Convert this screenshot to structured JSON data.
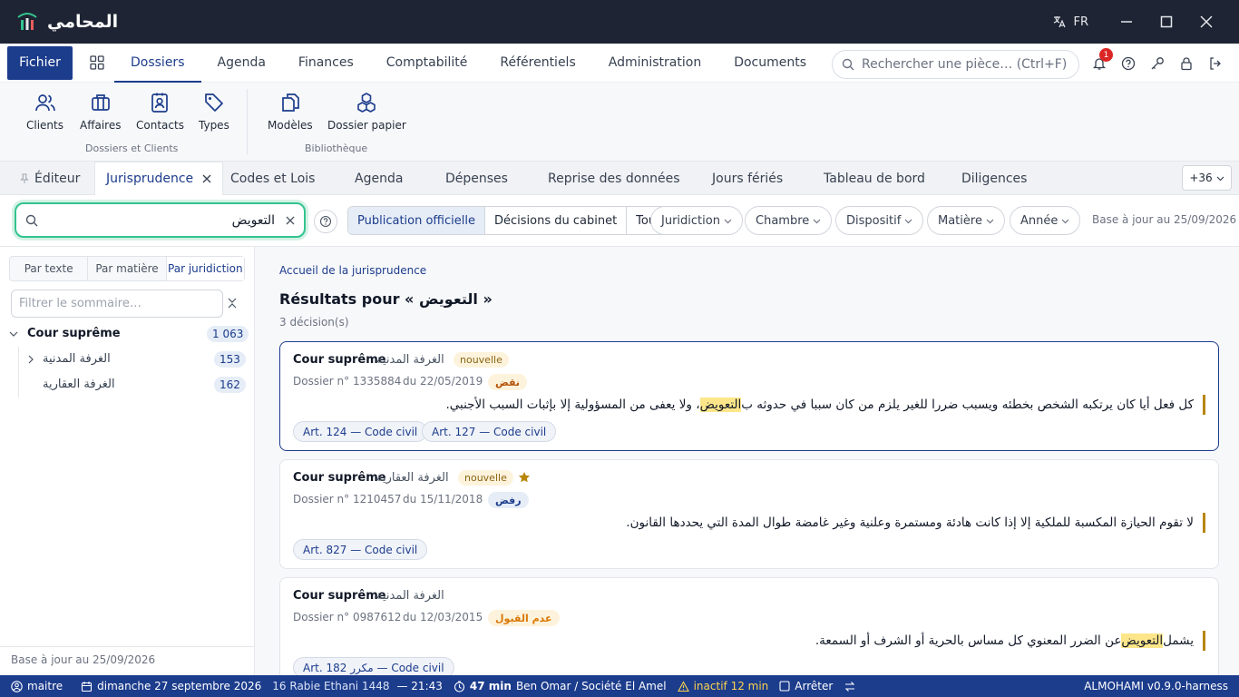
{
  "app": {
    "title": "المحامي",
    "lang": "FR"
  },
  "menubar": {
    "fichier": "Fichier",
    "items": [
      "Dossiers",
      "Agenda",
      "Finances",
      "Comptabilité",
      "Référentiels",
      "Administration",
      "Documents"
    ],
    "search_placeholder": "Rechercher une pièce… (Ctrl+F)",
    "notif_count": "1"
  },
  "ribbon": {
    "items": [
      "Clients",
      "Affaires",
      "Contacts",
      "Types",
      "Modèles",
      "Dossier papier"
    ],
    "groups": [
      "Dossiers et Clients",
      "Bibliothèque"
    ]
  },
  "tabs": {
    "items": [
      "Éditeur",
      "Jurisprudence",
      "Codes et Lois",
      "Agenda",
      "Dépenses",
      "Reprise des données",
      "Jours fériés",
      "Tableau de bord",
      "Diligences"
    ],
    "more": "+36"
  },
  "filters": {
    "query": "التعويض",
    "segments": [
      "Publication officielle",
      "Décisions du cabinet",
      "Tout"
    ],
    "dropdowns": [
      "Juridiction",
      "Chambre",
      "Dispositif",
      "Matière",
      "Année"
    ],
    "base_note": "Base à jour au 25/09/2026"
  },
  "sidebar": {
    "modes": [
      "Par texte",
      "Par matière",
      "Par juridiction"
    ],
    "filter_placeholder": "Filtrer le sommaire…",
    "tree": {
      "root": {
        "label": "Cour suprême",
        "count": "1 063"
      },
      "children": [
        {
          "label": "الغرفة المدنية",
          "count": "153"
        },
        {
          "label": "الغرفة العقارية",
          "count": "162"
        }
      ]
    },
    "footer": "Base à jour au 25/09/2026"
  },
  "main": {
    "breadcrumb": "Accueil de la jurisprudence",
    "title": "Résultats pour « التعويض »",
    "count": "3 décision(s)",
    "results": [
      {
        "court": "Cour suprême",
        "chamber": "الغرفة المدنية",
        "badge": "nouvelle",
        "dossier": "Dossier n° 1335884",
        "date": "du 22/05/2019",
        "verdict": "نقض",
        "quote_before": "كل فعل أيا كان يرتكبه الشخص بخطئه ويسبب ضررا للغير يلزم من كان سببا في حدوثه ب",
        "quote_hl": "التعويض",
        "quote_after": "، ولا يعفى من المسؤولية إلا بإثبات السبب الأجنبي.",
        "articles": [
          "Art. 124 — Code civil",
          "Art. 127 — Code civil"
        ]
      },
      {
        "court": "Cour suprême",
        "chamber": "الغرفة العقارية",
        "badge": "nouvelle",
        "dossier": "Dossier n° 1210457",
        "date": "du 15/11/2018",
        "verdict": "رفض",
        "quote": "لا تقوم الحيازة المكسبة للملكية إلا إذا كانت هادئة ومستمرة وعلنية وغير غامضة طوال المدة التي يحددها القانون.",
        "articles": [
          "Art. 827 — Code civil"
        ]
      },
      {
        "court": "Cour suprême",
        "chamber": "الغرفة المدنية",
        "dossier": "Dossier n° 0987612",
        "date": "du 12/03/2015",
        "verdict": "عدم القبول",
        "quote_before": "يشمل ",
        "quote_hl": "التعويض",
        "quote_after": " عن الضرر المعنوي كل مساس بالحرية أو الشرف أو السمعة.",
        "articles": [
          "Art. 182 مكرر — Code civil"
        ]
      }
    ]
  },
  "status": {
    "user": "maitre",
    "date": "dimanche 27 septembre 2026",
    "hijri": "16 Rabie Ethani 1448",
    "time": "— 21:43",
    "timer": "47 min",
    "client": "Ben Omar / Société El Amel",
    "inactive": "inactif 12 min",
    "stop": "Arrêter",
    "version": "ALMOHAMI v0.9.0-harness"
  },
  "colors": {
    "brand": "#1c3c8c",
    "titlebar": "#1e2433",
    "accent_green": "#34c38f",
    "highlight": "#fde68a"
  }
}
